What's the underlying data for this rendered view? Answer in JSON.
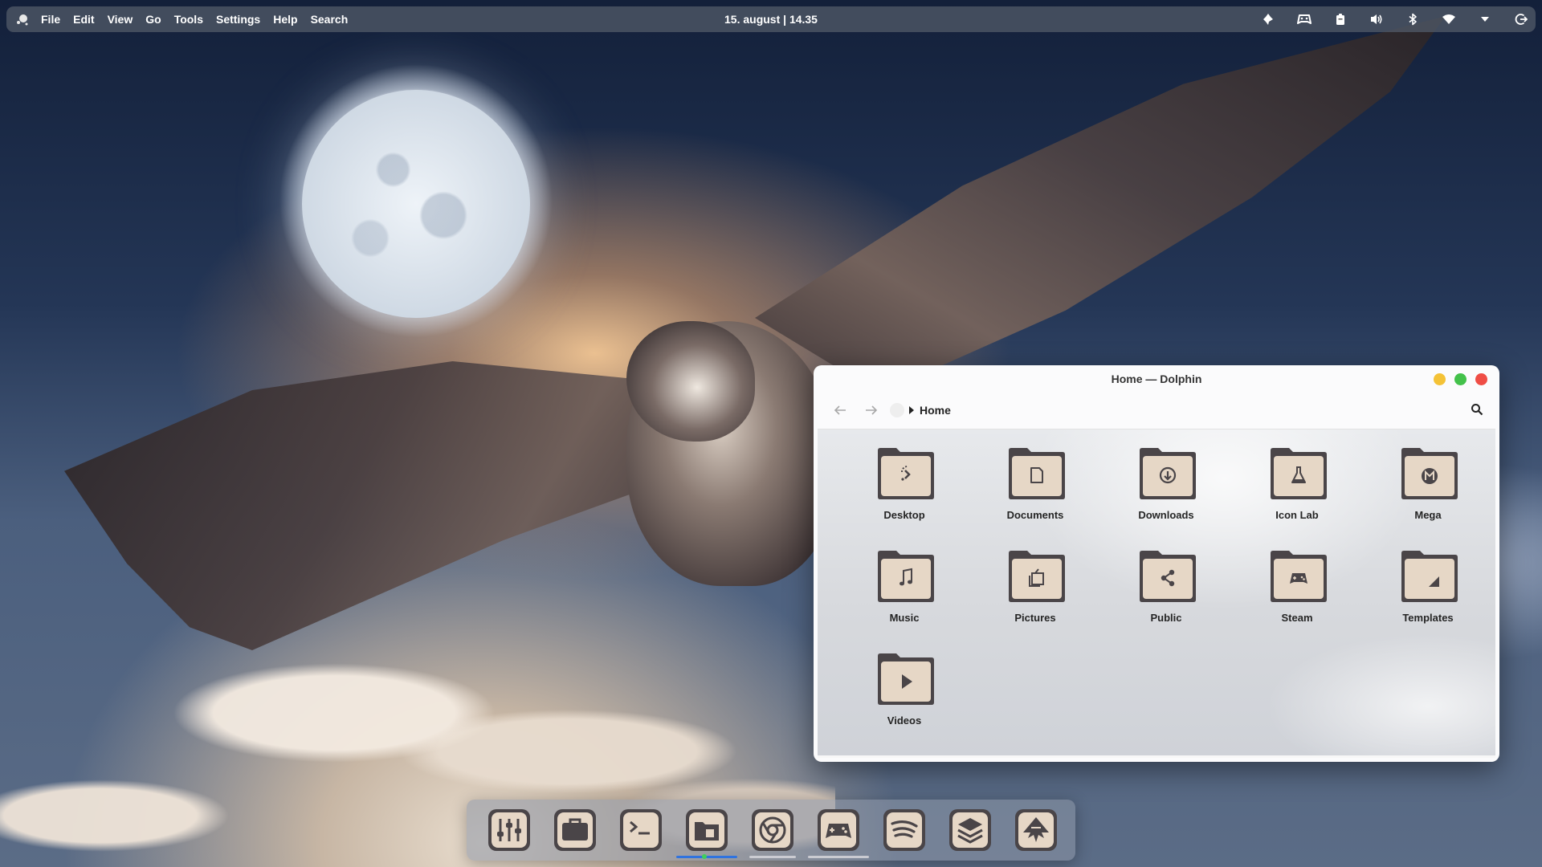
{
  "top_panel": {
    "launcher_icon": "kde-launcher-icon",
    "menu": [
      {
        "label": "File"
      },
      {
        "label": "Edit"
      },
      {
        "label": "View"
      },
      {
        "label": "Go"
      },
      {
        "label": "Tools"
      },
      {
        "label": "Settings"
      },
      {
        "label": "Help"
      },
      {
        "label": "Search"
      }
    ],
    "clock": "15. august | 14.35",
    "tray": [
      {
        "icon": "notification-bell-icon"
      },
      {
        "icon": "steam-gamepad-icon"
      },
      {
        "icon": "clipboard-icon"
      },
      {
        "icon": "volume-icon"
      },
      {
        "icon": "bluetooth-icon"
      },
      {
        "icon": "wifi-icon"
      },
      {
        "icon": "expand-arrow-icon"
      },
      {
        "icon": "power-icon"
      }
    ]
  },
  "window": {
    "title": "Home — Dolphin",
    "breadcrumb": "Home",
    "accent_colors": {
      "minimize": "#f4c236",
      "maximize": "#43c14a",
      "close": "#ef4d45"
    },
    "items": [
      {
        "label": "Desktop",
        "icon": "desktop-folder-icon"
      },
      {
        "label": "Documents",
        "icon": "documents-folder-icon"
      },
      {
        "label": "Downloads",
        "icon": "downloads-folder-icon"
      },
      {
        "label": "Icon Lab",
        "icon": "flask-folder-icon"
      },
      {
        "label": "Mega",
        "icon": "mega-folder-icon"
      },
      {
        "label": "Music",
        "icon": "music-folder-icon"
      },
      {
        "label": "Pictures",
        "icon": "pictures-folder-icon"
      },
      {
        "label": "Public",
        "icon": "share-folder-icon"
      },
      {
        "label": "Steam",
        "icon": "gamepad-folder-icon"
      },
      {
        "label": "Templates",
        "icon": "templates-folder-icon"
      },
      {
        "label": "Videos",
        "icon": "videos-folder-icon"
      }
    ]
  },
  "dock": {
    "items": [
      {
        "icon": "mixer-settings-icon",
        "app": "System Settings",
        "state": "none"
      },
      {
        "icon": "briefcase-icon",
        "app": "Discover",
        "state": "none"
      },
      {
        "icon": "terminal-icon",
        "app": "Konsole",
        "state": "none"
      },
      {
        "icon": "file-manager-icon",
        "app": "Dolphin",
        "state": "active"
      },
      {
        "icon": "chrome-icon",
        "app": "Chrome",
        "state": "open"
      },
      {
        "icon": "gamepad-icon",
        "app": "Steam",
        "state": "open"
      },
      {
        "icon": "spotify-icon",
        "app": "Spotify",
        "state": "none"
      },
      {
        "icon": "layers-icon",
        "app": "Layers",
        "state": "none"
      },
      {
        "icon": "inkscape-icon",
        "app": "Inkscape",
        "state": "none"
      }
    ],
    "indicator_colors": {
      "active": "#2f73df",
      "open": "#d2d2d7",
      "dot": "#3ecf5b"
    }
  }
}
